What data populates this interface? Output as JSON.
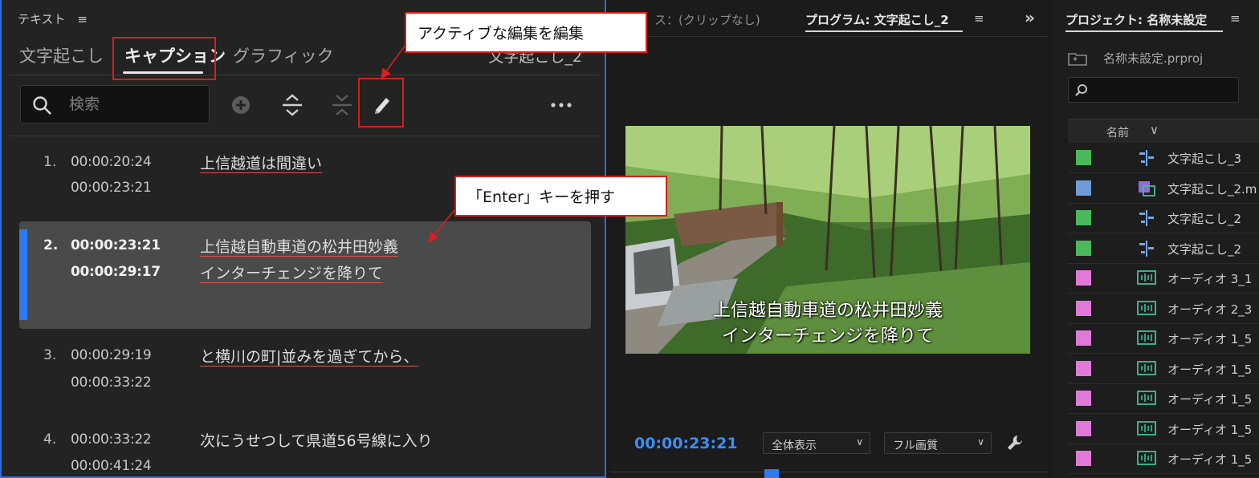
{
  "text_panel": {
    "title": "テキスト",
    "tabs": [
      "文字起こし",
      "キャプション",
      "グラフィック"
    ],
    "clip_name": "文字起こし_2",
    "search_placeholder": "検索",
    "captions": [
      {
        "num": "1.",
        "start": "00:00:20:24",
        "end": "00:00:23:21",
        "lines": [
          "上信越道は間違い"
        ]
      },
      {
        "num": "2.",
        "start": "00:00:23:21",
        "end": "00:00:29:17",
        "lines": [
          "上信越自動車道の松井田妙義",
          "インターチェンジを降りて"
        ]
      },
      {
        "num": "3.",
        "start": "00:00:29:19",
        "end": "00:00:33:22",
        "lines": [
          "と横川の町|並みを過ぎてから、"
        ]
      },
      {
        "num": "4.",
        "start": "00:00:33:22",
        "end": "00:00:41:24",
        "lines": [
          "次にうせつして県道56号線に入り"
        ]
      }
    ]
  },
  "program_panel": {
    "source_tab": "ス：(クリップなし)",
    "program_tab": "プログラム: 文字起こし_2",
    "subtitle_lines": [
      "上信越自動車道の松井田妙義",
      "インターチェンジを降りて"
    ],
    "timecode": "00:00:23:21",
    "zoom_select": "全体表示",
    "quality_select": "フル画質"
  },
  "project_panel": {
    "title": "プロジェクト: 名称未設定",
    "file": "名称未設定.prproj",
    "column_name": "名前",
    "items": [
      {
        "label": "文字起こし_3",
        "color": "#4cb85c",
        "icon": "caption-sequence-icon"
      },
      {
        "label": "文字起こし_2.m",
        "color": "#6f9bd6",
        "icon": "video-clip-icon"
      },
      {
        "label": "文字起こし_2",
        "color": "#4cb85c",
        "icon": "caption-sequence-icon"
      },
      {
        "label": "文字起こし_2",
        "color": "#4cb85c",
        "icon": "caption-sequence-icon"
      },
      {
        "label": "オーディオ 3_1",
        "color": "#e07ad8",
        "icon": "audio-clip-icon"
      },
      {
        "label": "オーディオ 2_3",
        "color": "#e07ad8",
        "icon": "audio-clip-icon"
      },
      {
        "label": "オーディオ 1_5",
        "color": "#e07ad8",
        "icon": "audio-clip-icon"
      },
      {
        "label": "オーディオ 1_5",
        "color": "#e07ad8",
        "icon": "audio-clip-icon"
      },
      {
        "label": "オーディオ 1_5",
        "color": "#e07ad8",
        "icon": "audio-clip-icon"
      },
      {
        "label": "オーディオ 1_5",
        "color": "#e07ad8",
        "icon": "audio-clip-icon"
      },
      {
        "label": "オーディオ 1_5",
        "color": "#e07ad8",
        "icon": "audio-clip-icon"
      }
    ]
  },
  "callouts": {
    "edit_active": "アクティブな編集を編集",
    "enter_key": "「Enter」キーを押す"
  },
  "colors": {
    "accent": "#2d7bf0",
    "highlight": "#d81e1e"
  }
}
